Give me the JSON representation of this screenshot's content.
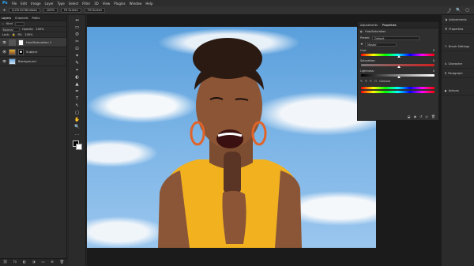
{
  "menubar": {
    "logo": "Ps",
    "items": [
      "File",
      "Edit",
      "Image",
      "Layer",
      "Type",
      "Select",
      "Filter",
      "3D",
      "View",
      "Plugins",
      "Window",
      "Help"
    ]
  },
  "options": {
    "chips": [
      "Q-Fill All Windows",
      "100%",
      "Fit Screen",
      "Fill Screen"
    ],
    "share": "⤴",
    "search": "🔍",
    "workspace": "▢"
  },
  "layers_panel": {
    "tabs": [
      "Layers",
      "Channels",
      "Paths"
    ],
    "kind_label": "Kind",
    "blend": "Normal",
    "opacity_label": "Opacity:",
    "opacity": "100%",
    "lock_label": "Lock:",
    "fill_label": "Fill:",
    "fill": "100%",
    "layers": [
      {
        "name": "Hue/Saturation 1",
        "type": "adjustment"
      },
      {
        "name": "Subject",
        "type": "image"
      },
      {
        "name": "Background",
        "type": "background"
      }
    ],
    "footer_icons": [
      "⛓",
      "fx",
      "◧",
      "◑",
      "▭",
      "⊕",
      "🗑"
    ]
  },
  "tools": [
    "↔",
    "▭",
    "ʘ",
    "✂",
    "⊡",
    "✦",
    "✎",
    "⌖",
    "◐",
    "▲",
    "✒",
    "T",
    "↖",
    "▢",
    "✋",
    "🔍",
    "…"
  ],
  "properties": {
    "tabs": [
      "Adjustments",
      "Properties"
    ],
    "title": "Hue/Saturation",
    "preset_label": "Preset:",
    "preset": "Default",
    "channel": "Master",
    "hue_label": "Hue:",
    "hue": "0",
    "saturation_label": "Saturation:",
    "saturation": "0",
    "lightness_label": "Lightness:",
    "lightness": "0",
    "colorize_label": "Colorize"
  },
  "right_panel": {
    "items": [
      "Adjustments",
      "Properties",
      "Brush Settings",
      "Character",
      "Paragraph",
      "Actions"
    ]
  },
  "colors": {
    "accent": "#31a8ff",
    "hue_strip": [
      "#ff0000",
      "#ffff00",
      "#00ff00",
      "#00ffff",
      "#0000ff",
      "#ff00ff",
      "#ff0000"
    ]
  }
}
